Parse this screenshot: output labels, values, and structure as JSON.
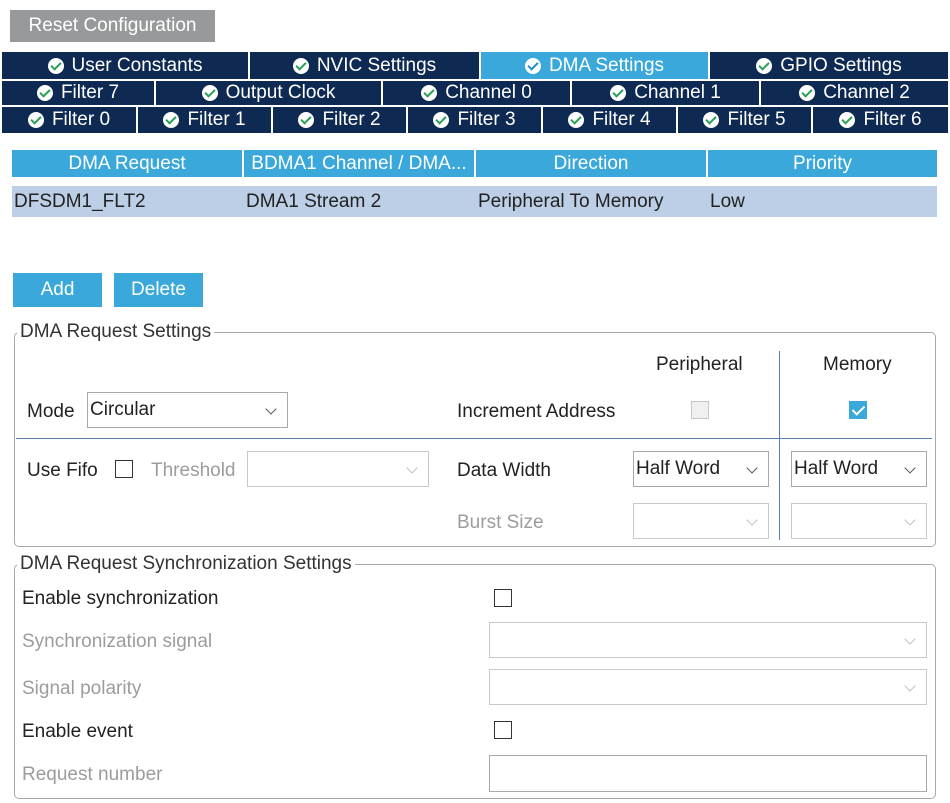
{
  "reset_button": "Reset Configuration",
  "tabs_row1": [
    {
      "label": "User Constants",
      "active": false
    },
    {
      "label": "NVIC Settings",
      "active": false
    },
    {
      "label": "DMA Settings",
      "active": true
    },
    {
      "label": "GPIO Settings",
      "active": false
    }
  ],
  "tabs_row2": [
    {
      "label": "Filter 7"
    },
    {
      "label": "Output Clock"
    },
    {
      "label": "Channel 0"
    },
    {
      "label": "Channel 1"
    },
    {
      "label": "Channel 2"
    }
  ],
  "tabs_row3": [
    {
      "label": "Filter 0"
    },
    {
      "label": "Filter 1"
    },
    {
      "label": "Filter 2"
    },
    {
      "label": "Filter 3"
    },
    {
      "label": "Filter 4"
    },
    {
      "label": "Filter 5"
    },
    {
      "label": "Filter 6"
    }
  ],
  "table": {
    "headers": [
      "DMA Request",
      "BDMA1 Channel / DMA...",
      "Direction",
      "Priority"
    ],
    "rows": [
      [
        "DFSDM1_FLT2",
        "DMA1 Stream 2",
        "Peripheral To Memory",
        "Low"
      ]
    ]
  },
  "buttons": {
    "add": "Add",
    "delete": "Delete"
  },
  "request_settings": {
    "legend": "DMA Request Settings",
    "peripheral_header": "Peripheral",
    "memory_header": "Memory",
    "mode_label": "Mode",
    "mode_value": "Circular",
    "increment_address_label": "Increment Address",
    "increment_peripheral": false,
    "increment_memory": true,
    "use_fifo_label": "Use Fifo",
    "use_fifo": false,
    "threshold_label": "Threshold",
    "threshold_value": "",
    "data_width_label": "Data Width",
    "data_width_peripheral": "Half Word",
    "data_width_memory": "Half Word",
    "burst_size_label": "Burst Size",
    "burst_peripheral": "",
    "burst_memory": ""
  },
  "sync_settings": {
    "legend": "DMA Request Synchronization Settings",
    "enable_sync_label": "Enable synchronization",
    "enable_sync": false,
    "sync_signal_label": "Synchronization signal",
    "signal_polarity_label": "Signal polarity",
    "enable_event_label": "Enable event",
    "enable_event": false,
    "request_number_label": "Request number",
    "request_number_value": ""
  },
  "colors": {
    "tab_dark": "#0e2a52",
    "tab_active": "#3aa8db",
    "table_header": "#3aa8db",
    "table_row": "#bccfe6",
    "button_gray": "#97999b"
  }
}
